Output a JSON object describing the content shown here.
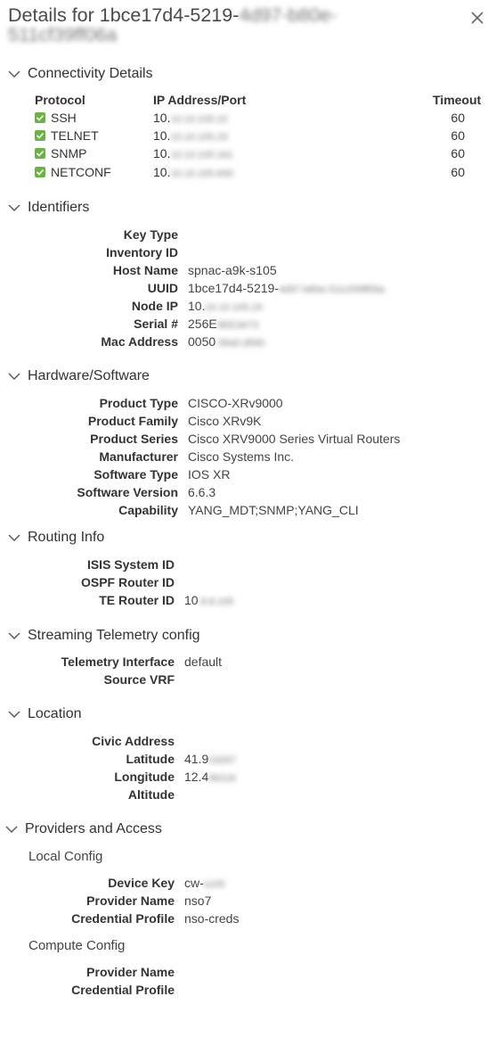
{
  "header": {
    "title_visible": "Details for 1bce17d4-5219-",
    "title_blurred": "4d97-b80e-",
    "title_line2_blurred": "511cf39ff06a"
  },
  "sections": {
    "connectivity": "Connectivity Details",
    "identifiers": "Identifiers",
    "hardware": "Hardware/Software",
    "routing": "Routing Info",
    "telemetry": "Streaming Telemetry config",
    "location": "Location",
    "providers": "Providers and Access"
  },
  "connectivity": {
    "headers": {
      "protocol": "Protocol",
      "ip": "IP Address/Port",
      "timeout": "Timeout"
    },
    "rows": [
      {
        "protocol": "SSH",
        "ip": "10.",
        "ip_blurred": "10.10.105.22",
        "timeout": "60"
      },
      {
        "protocol": "TELNET",
        "ip": "10.",
        "ip_blurred": "10.10.105.23",
        "timeout": "60"
      },
      {
        "protocol": "SNMP",
        "ip": "10.",
        "ip_blurred": "10.10.105.161",
        "timeout": "60"
      },
      {
        "protocol": "NETCONF",
        "ip": "10.",
        "ip_blurred": "10.10.105.830",
        "timeout": "60"
      }
    ]
  },
  "identifiers": {
    "key_type": "Key Type",
    "inventory_id": "Inventory ID",
    "host_name_label": "Host Name",
    "host_name": "spnac-a9k-s105",
    "uuid_label": "UUID",
    "uuid": "1bce17d4-5219-",
    "uuid_blurred": "4d97-b80e-511cf39ff06a",
    "node_ip_label": "Node IP",
    "node_ip": "10.",
    "node_ip_blurred": "10.10.105.24",
    "serial_label": "Serial #",
    "serial": "256E",
    "serial_blurred": "5EE3A73",
    "mac_label": "Mac Address",
    "mac": "0050",
    "mac_blurred": ".56a0.d590"
  },
  "hardware": {
    "product_type_label": "Product Type",
    "product_type": "CISCO-XRv9000",
    "product_family_label": "Product Family",
    "product_family": "Cisco XRv9K",
    "product_series_label": "Product Series",
    "product_series": "Cisco XRV9000 Series Virtual Routers",
    "manufacturer_label": "Manufacturer",
    "manufacturer": "Cisco Systems Inc.",
    "software_type_label": "Software Type",
    "software_type": "IOS XR",
    "software_version_label": "Software Version",
    "software_version": "6.6.3",
    "capability_label": "Capability",
    "capability": "YANG_MDT;SNMP;YANG_CLI"
  },
  "routing": {
    "isis_label": "ISIS System ID",
    "ospf_label": "OSPF Router ID",
    "te_label": "TE Router ID",
    "te": "10",
    "te_blurred": ".8.8.105"
  },
  "telemetry": {
    "interface_label": "Telemetry Interface",
    "interface": "default",
    "vrf_label": "Source VRF"
  },
  "location": {
    "civic_label": "Civic Address",
    "lat_label": "Latitude",
    "lat": "41.9",
    "lat_blurred": "03297",
    "long_label": "Longitude",
    "long": "12.4",
    "long_blurred": "96216",
    "alt_label": "Altitude"
  },
  "providers": {
    "local_config": "Local Config",
    "device_key_label": "Device Key",
    "device_key": "cw-",
    "device_key_blurred": "s105",
    "provider_name_label": "Provider Name",
    "provider_name": "nso7",
    "cred_label": "Credential Profile",
    "cred": "nso-creds",
    "compute_config": "Compute Config",
    "compute_provider_label": "Provider Name",
    "compute_cred_label": "Credential Profile"
  }
}
